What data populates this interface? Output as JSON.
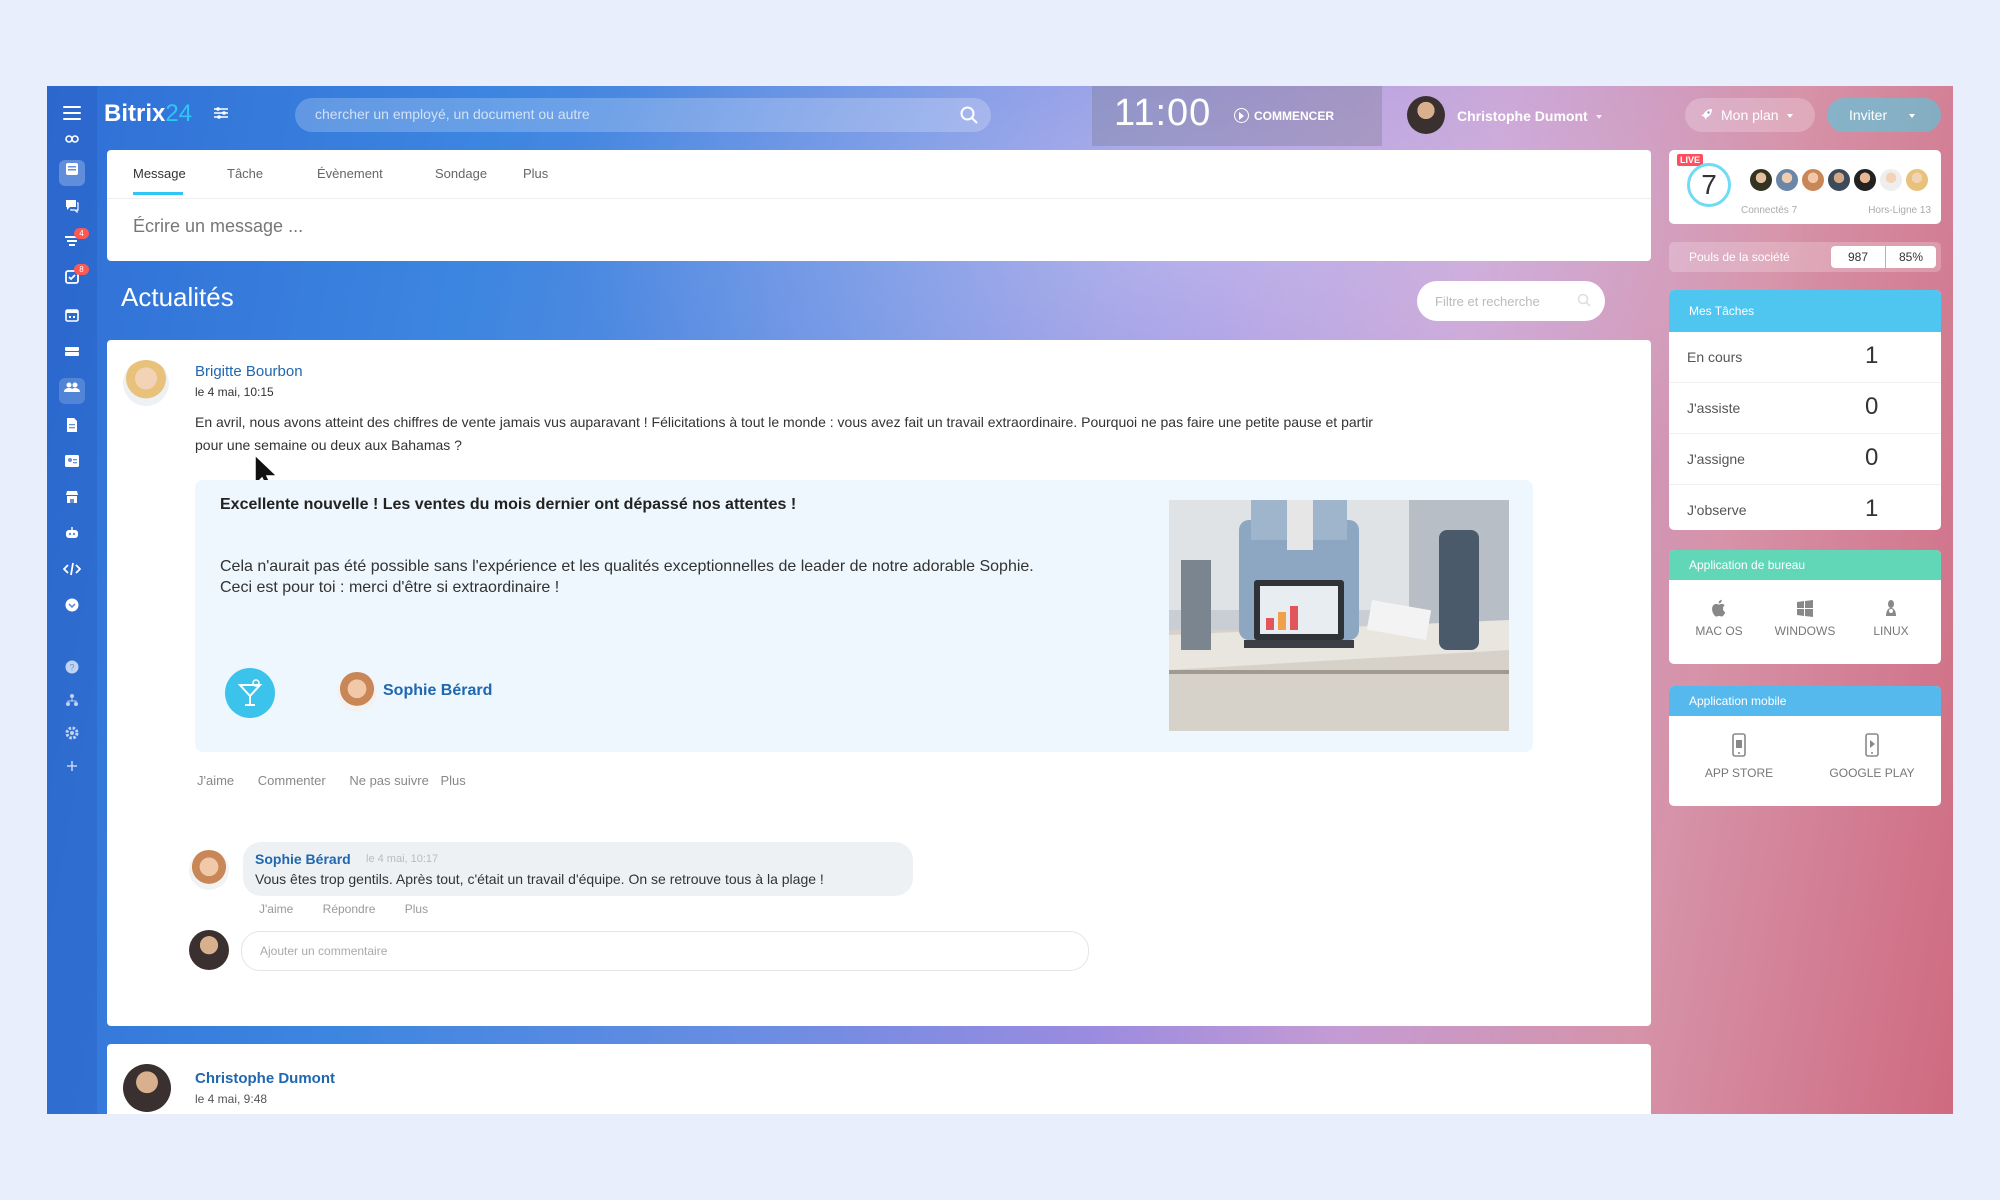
{
  "header": {
    "logo_text": "Bitrix",
    "logo_number": "24",
    "search_placeholder": "chercher un employé, un document ou autre",
    "clock": "11:00",
    "start_label": "COMMENCER",
    "user_name": "Christophe Dumont",
    "plan_label": "Mon plan",
    "invite_label": "Inviter"
  },
  "sidebar": {
    "badges": {
      "feed_filter": "4",
      "tasks": "8"
    }
  },
  "composer": {
    "tabs": [
      {
        "label": "Message",
        "active": true
      },
      {
        "label": "Tâche"
      },
      {
        "label": "Évènement"
      },
      {
        "label": "Sondage"
      },
      {
        "label": "Plus"
      }
    ],
    "placeholder": "Écrire un message ..."
  },
  "feed": {
    "title": "Actualités",
    "filter_placeholder": "Filtre et recherche",
    "post": {
      "author": "Brigitte Bourbon",
      "date": "le 4 mai, 10:15",
      "text": "En avril, nous avons atteint des chiffres de vente jamais vus auparavant ! Félicitations à tout le monde : vous avez fait un travail extraordinaire. Pourquoi ne pas faire une petite pause et partir pour une semaine ou deux aux Bahamas ?",
      "gratitude": {
        "title": "Excellente nouvelle ! Les ventes du mois dernier ont dépassé nos attentes !",
        "line1": "Cela n'aurait pas été possible sans l'expérience et les qualités exceptionnelles de leader de notre adorable Sophie.",
        "line2": "Ceci est pour toi : merci d'être si extraordinaire !",
        "recipient": "Sophie Bérard"
      },
      "actions": {
        "like": "J'aime",
        "comment": "Commenter",
        "unfollow": "Ne pas suivre",
        "more": "Plus"
      },
      "comment": {
        "author": "Sophie Bérard",
        "date": "le 4 mai, 10:17",
        "text": "Vous êtes trop gentils. Après tout, c'était un travail d'équipe. On se retrouve tous à la plage !",
        "actions": {
          "like": "J'aime",
          "reply": "Répondre",
          "more": "Plus"
        }
      },
      "add_comment_placeholder": "Ajouter un commentaire"
    },
    "post2": {
      "author": "Christophe Dumont",
      "date": "le 4 mai, 9:48"
    }
  },
  "right": {
    "live": "LIVE",
    "online_count": "7",
    "connected": "Connectés 7",
    "offline": "Hors-Ligne 13",
    "pulse_label": "Pouls de la société",
    "pulse_value": "987",
    "pulse_percent": "85%",
    "tasks_title": "Mes Tâches",
    "tasks": [
      {
        "label": "En cours",
        "count": "1"
      },
      {
        "label": "J'assiste",
        "count": "0"
      },
      {
        "label": "J'assigne",
        "count": "0"
      },
      {
        "label": "J'observe",
        "count": "1"
      }
    ],
    "desktop_title": "Application de bureau",
    "desktop": [
      "MAC OS",
      "WINDOWS",
      "LINUX"
    ],
    "mobile_title": "Application mobile",
    "mobile": [
      "APP STORE",
      "GOOGLE PLAY"
    ]
  },
  "colors": {
    "accent": "#2fc6f6",
    "link": "#2067b0",
    "tasks_head": "#4fc6f0",
    "desktop_head": "#62d7b8",
    "mobile_head": "#56b9ee",
    "live": "#ff4f5e"
  }
}
